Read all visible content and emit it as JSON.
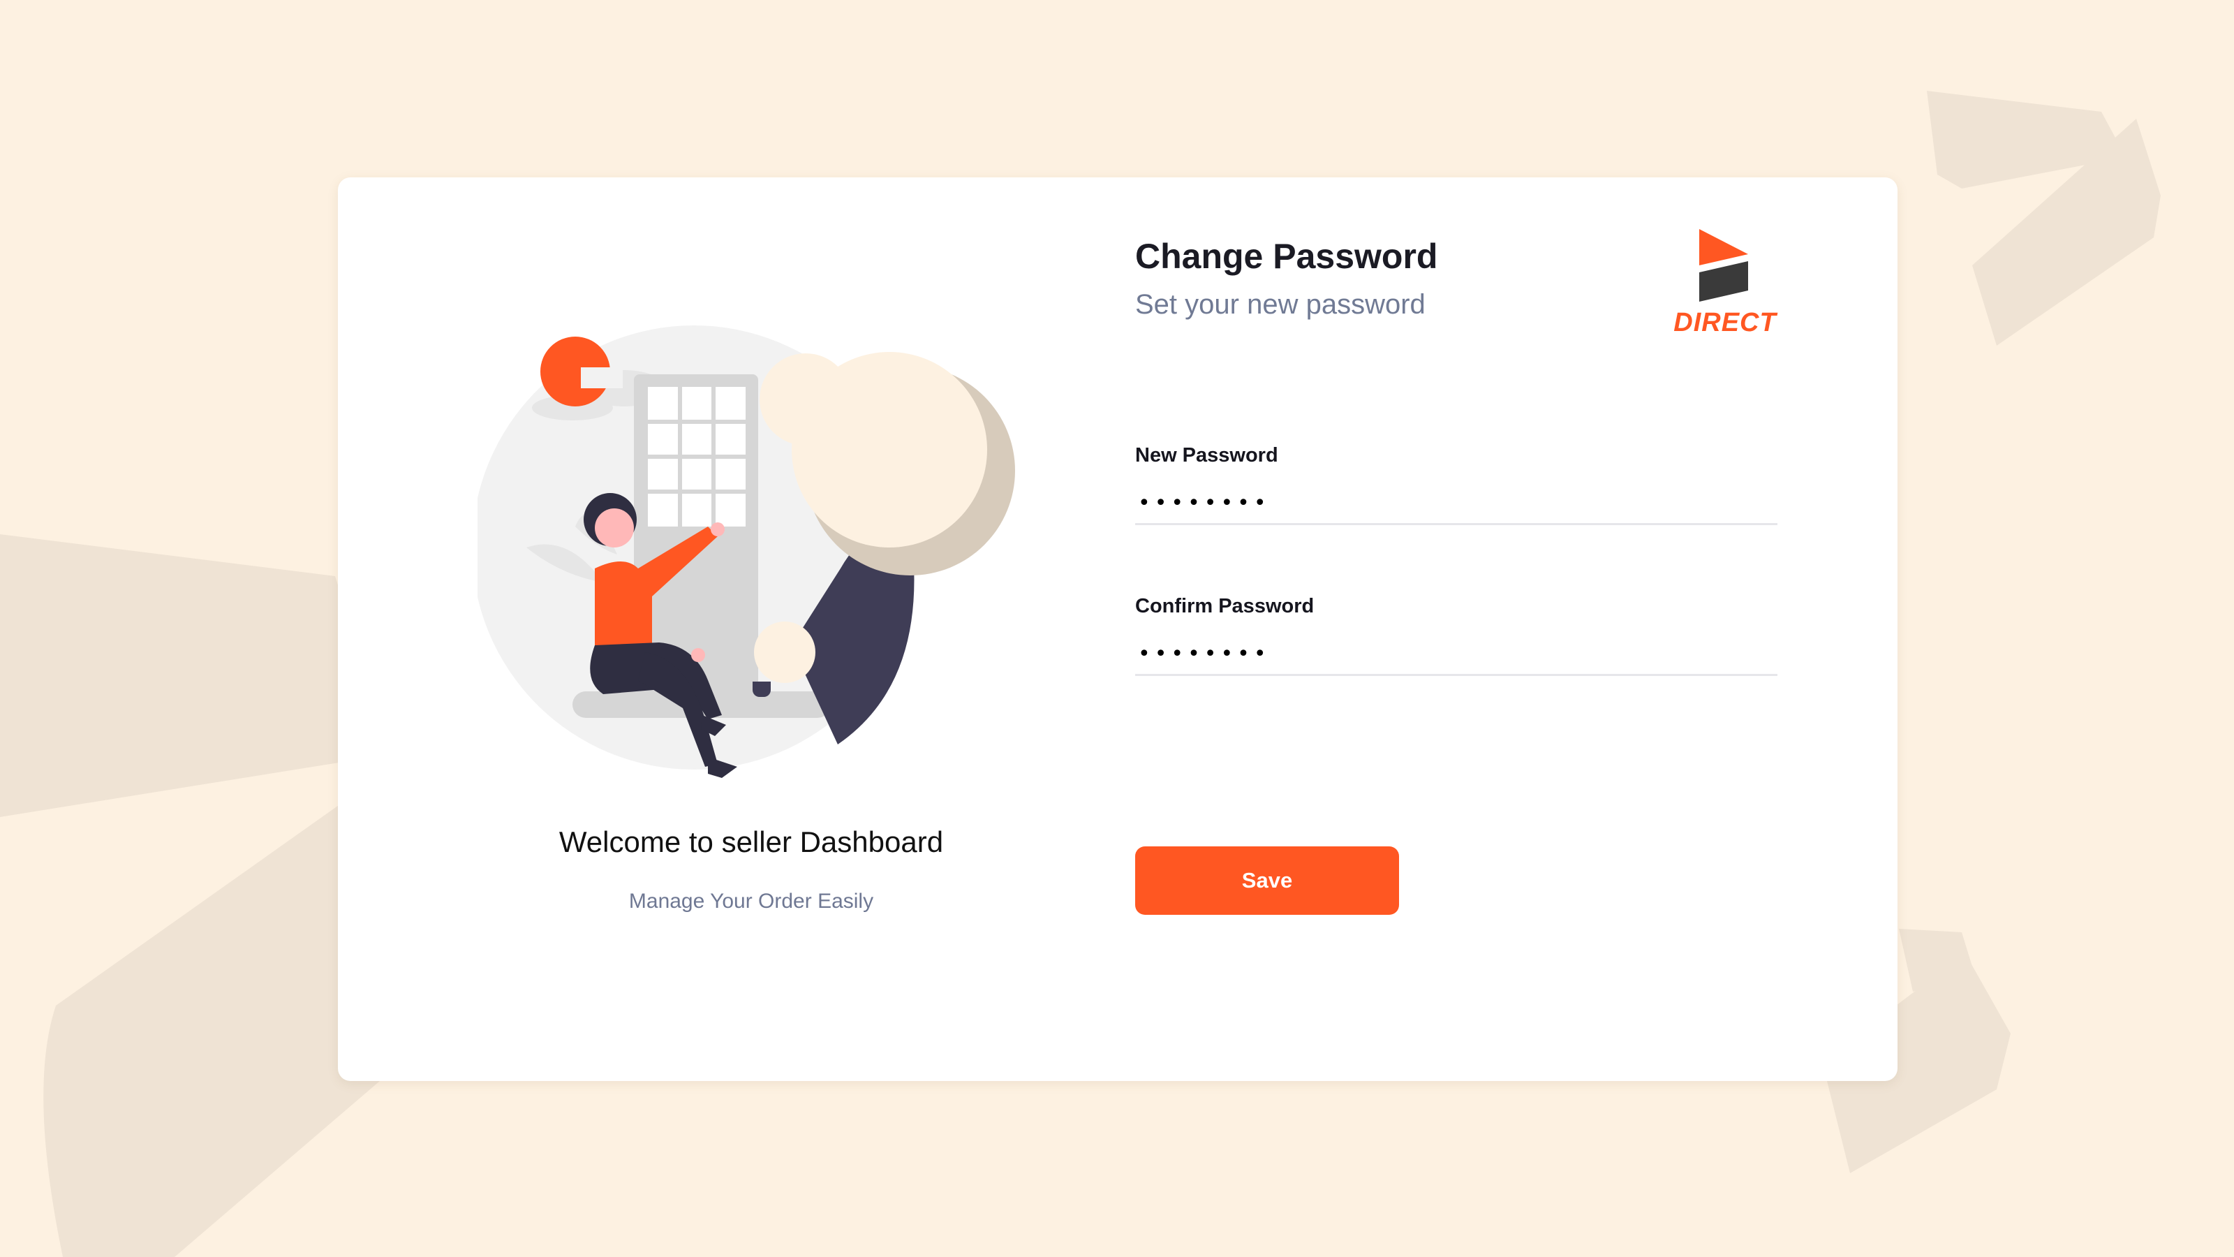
{
  "welcome": {
    "title": "Welcome to seller Dashboard",
    "subtitle": "Manage Your Order Easily"
  },
  "form": {
    "title": "Change Password",
    "subtitle": "Set your new password",
    "fields": [
      {
        "label": "New Password",
        "value": "12345678",
        "type": "password"
      },
      {
        "label": "Confirm Password",
        "value": "12345678",
        "type": "password"
      }
    ],
    "save_label": "Save"
  },
  "brand": {
    "name": "DIRECT",
    "logo_icon": "direct-play-logo-icon"
  },
  "colors": {
    "background": "#fdf1e1",
    "accent": "#ff5722",
    "card": "#ffffff",
    "subtitle": "#707a94"
  }
}
